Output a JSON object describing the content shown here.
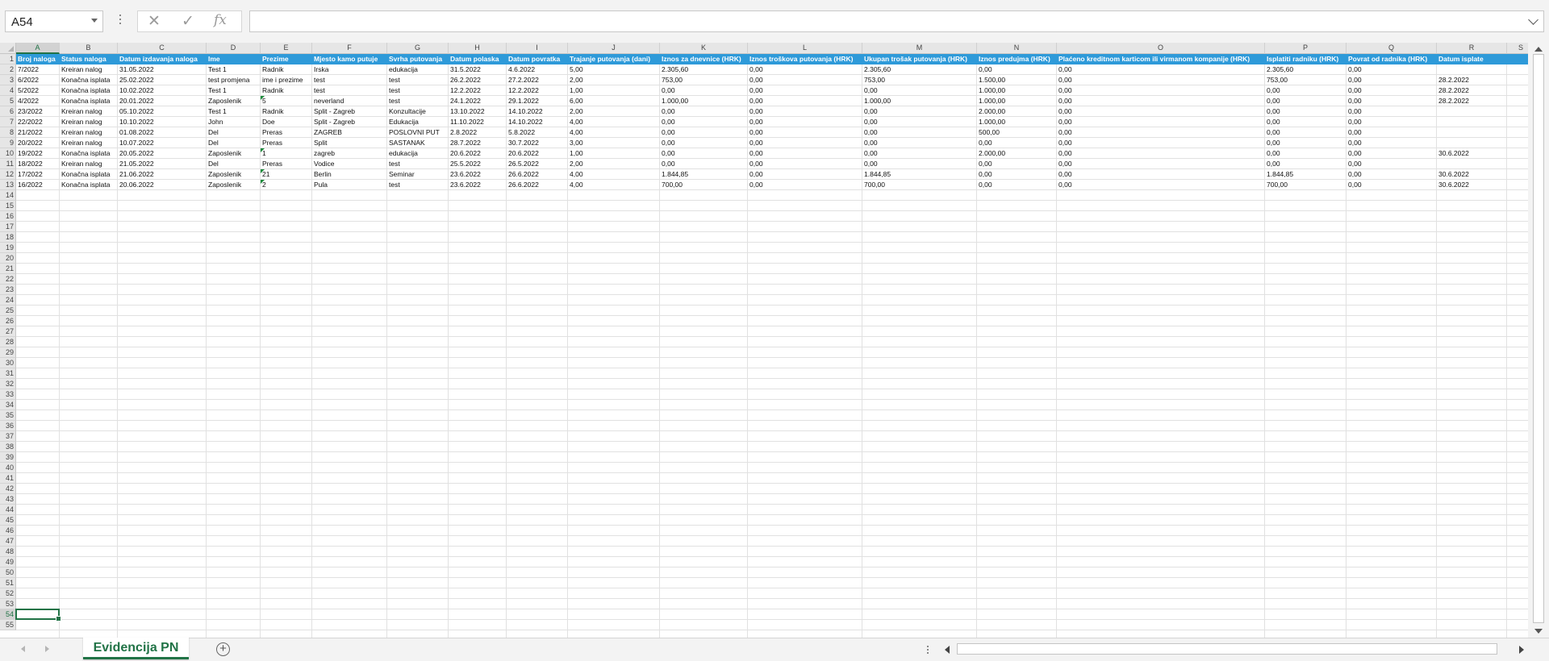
{
  "name_box": "A54",
  "formula_bar": {
    "cancel_icon": "✕",
    "enter_icon": "✓",
    "fx_label": "fx",
    "formula": ""
  },
  "colors": {
    "header_fill": "#2e9ad9",
    "accent": "#217346"
  },
  "columns": [
    "A",
    "B",
    "C",
    "D",
    "E",
    "F",
    "G",
    "H",
    "I",
    "J",
    "K",
    "L",
    "M",
    "N",
    "O",
    "P",
    "Q",
    "R",
    "S"
  ],
  "headers": [
    "Broj naloga",
    "Status naloga",
    "Datum izdavanja naloga",
    "Ime",
    "Prezime",
    "Mjesto kamo putuje",
    "Svrha putovanja",
    "Datum polaska",
    "Datum povratka",
    "Trajanje putovanja (dani)",
    "Iznos za dnevnice (HRK)",
    "Iznos troškova putovanja (HRK)",
    "Ukupan trošak putovanja (HRK)",
    "Iznos predujma (HRK)",
    "Plaćeno kreditnom karticom ili virmanom kompanije (HRK)",
    "Isplatiti radniku (HRK)",
    "Povrat od radnika (HRK)",
    "Datum isplate",
    ""
  ],
  "rows": [
    [
      "7/2022",
      "Kreiran nalog",
      "31.05.2022",
      "Test 1",
      "Radnik",
      "Irska",
      "edukacija",
      "31.5.2022",
      "4.6.2022",
      "5,00",
      "2.305,60",
      "0,00",
      "2.305,60",
      "0,00",
      "0,00",
      "2.305,60",
      "0,00",
      "",
      ""
    ],
    [
      "6/2022",
      "Konačna isplata",
      "25.02.2022",
      "test promjena",
      "ime i prezime",
      "test",
      "test",
      "26.2.2022",
      "27.2.2022",
      "2,00",
      "753,00",
      "0,00",
      "753,00",
      "1.500,00",
      "0,00",
      "753,00",
      "0,00",
      "28.2.2022",
      ""
    ],
    [
      "5/2022",
      "Konačna isplata",
      "10.02.2022",
      "Test 1",
      "Radnik",
      "test",
      "test",
      "12.2.2022",
      "12.2.2022",
      "1,00",
      "0,00",
      "0,00",
      "0,00",
      "1.000,00",
      "0,00",
      "0,00",
      "0,00",
      "28.2.2022",
      ""
    ],
    [
      "4/2022",
      "Konačna isplata",
      "20.01.2022",
      "Zaposlenik",
      "5",
      "neverland",
      "test",
      "24.1.2022",
      "29.1.2022",
      "6,00",
      "1.000,00",
      "0,00",
      "1.000,00",
      "1.000,00",
      "0,00",
      "0,00",
      "0,00",
      "28.2.2022",
      ""
    ],
    [
      "23/2022",
      "Kreiran nalog",
      "05.10.2022",
      "Test 1",
      "Radnik",
      "Split - Zagreb",
      "Konzultacije",
      "13.10.2022",
      "14.10.2022",
      "2,00",
      "0,00",
      "0,00",
      "0,00",
      "2.000,00",
      "0,00",
      "0,00",
      "0,00",
      "",
      ""
    ],
    [
      "22/2022",
      "Kreiran nalog",
      "10.10.2022",
      "John",
      "Doe",
      "Split - Zagreb",
      "Edukacija",
      "11.10.2022",
      "14.10.2022",
      "4,00",
      "0,00",
      "0,00",
      "0,00",
      "1.000,00",
      "0,00",
      "0,00",
      "0,00",
      "",
      ""
    ],
    [
      "21/2022",
      "Kreiran nalog",
      "01.08.2022",
      "Del",
      "Preras",
      "ZAGREB",
      "POSLOVNI PUT",
      "2.8.2022",
      "5.8.2022",
      "4,00",
      "0,00",
      "0,00",
      "0,00",
      "500,00",
      "0,00",
      "0,00",
      "0,00",
      "",
      ""
    ],
    [
      "20/2022",
      "Kreiran nalog",
      "10.07.2022",
      "Del",
      "Preras",
      "Split",
      "SASTANAK",
      "28.7.2022",
      "30.7.2022",
      "3,00",
      "0,00",
      "0,00",
      "0,00",
      "0,00",
      "0,00",
      "0,00",
      "0,00",
      "",
      ""
    ],
    [
      "19/2022",
      "Konačna isplata",
      "20.05.2022",
      "Zaposlenik",
      "1",
      "zagreb",
      "edukacija",
      "20.6.2022",
      "20.6.2022",
      "1,00",
      "0,00",
      "0,00",
      "0,00",
      "2.000,00",
      "0,00",
      "0,00",
      "0,00",
      "30.6.2022",
      ""
    ],
    [
      "18/2022",
      "Kreiran nalog",
      "21.05.2022",
      "Del",
      "Preras",
      "Vodice",
      "test",
      "25.5.2022",
      "26.5.2022",
      "2,00",
      "0,00",
      "0,00",
      "0,00",
      "0,00",
      "0,00",
      "0,00",
      "0,00",
      "",
      ""
    ],
    [
      "17/2022",
      "Konačna isplata",
      "21.06.2022",
      "Zaposlenik",
      "21",
      "Berlin",
      "Seminar",
      "23.6.2022",
      "26.6.2022",
      "4,00",
      "1.844,85",
      "0,00",
      "1.844,85",
      "0,00",
      "0,00",
      "1.844,85",
      "0,00",
      "30.6.2022",
      ""
    ],
    [
      "16/2022",
      "Konačna isplata",
      "20.06.2022",
      "Zaposlenik",
      "2",
      "Pula",
      "test",
      "23.6.2022",
      "26.6.2022",
      "4,00",
      "700,00",
      "0,00",
      "700,00",
      "0,00",
      "0,00",
      "700,00",
      "0,00",
      "30.6.2022",
      ""
    ]
  ],
  "text_number_warnings": [
    [
      3,
      4
    ],
    [
      8,
      4
    ],
    [
      10,
      4
    ],
    [
      11,
      4
    ]
  ],
  "row_count": 55,
  "active_cell": {
    "col": "A",
    "row": 54
  },
  "sheet_tabs": [
    {
      "label": "Evidencija PN",
      "active": true
    }
  ],
  "icons": {
    "add_sheet": "+",
    "namebox_dropdown": "chevron-down-icon"
  }
}
